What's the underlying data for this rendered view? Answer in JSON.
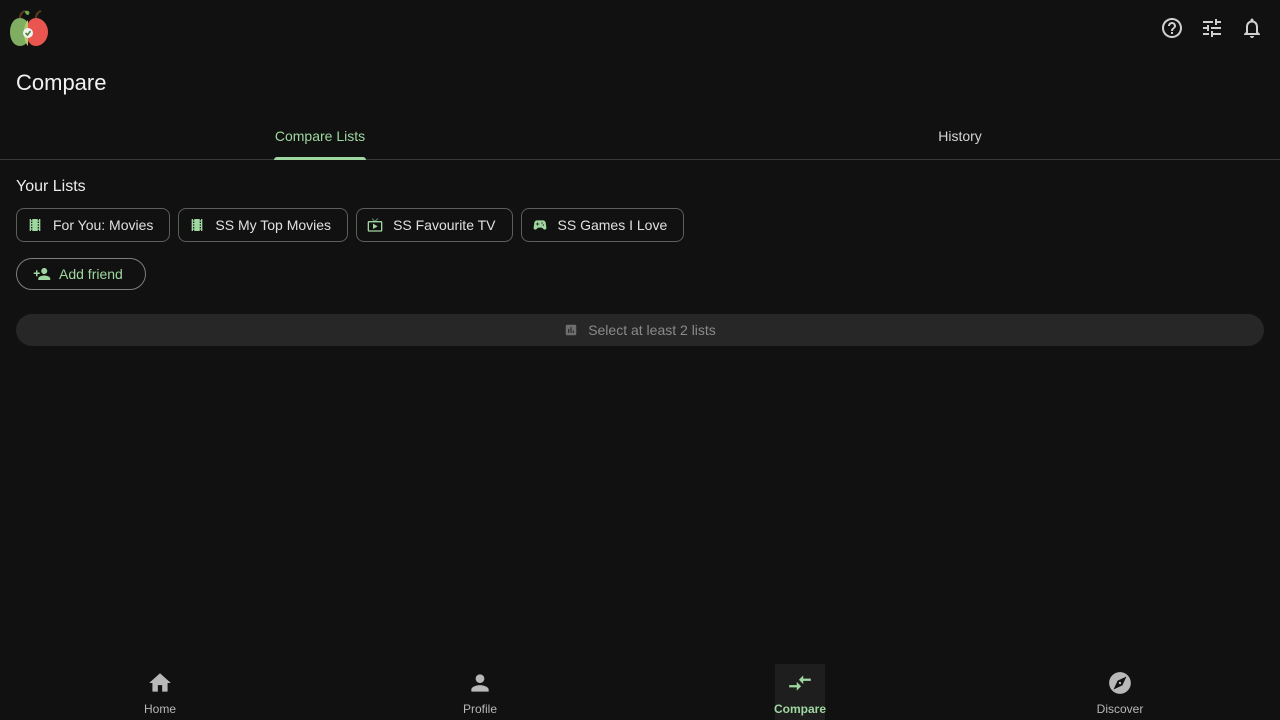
{
  "header": {
    "icons": [
      "help-icon",
      "tune-icon",
      "bell-icon"
    ]
  },
  "page": {
    "title": "Compare"
  },
  "tabs": [
    {
      "label": "Compare Lists",
      "active": true
    },
    {
      "label": "History",
      "active": false
    }
  ],
  "lists_section": {
    "title": "Your Lists",
    "chips": [
      {
        "label": "For You: Movies",
        "icon": "movie-icon"
      },
      {
        "label": "SS My Top Movies",
        "icon": "movie-icon"
      },
      {
        "label": "SS Favourite TV",
        "icon": "tv-icon"
      },
      {
        "label": "SS Games I Love",
        "icon": "gamepad-icon"
      }
    ],
    "add_friend_label": "Add friend",
    "compare_button_label": "Select at least 2 lists"
  },
  "bottom_nav": [
    {
      "label": "Home",
      "icon": "home-icon",
      "active": false
    },
    {
      "label": "Profile",
      "icon": "person-icon",
      "active": false
    },
    {
      "label": "Compare",
      "icon": "compare-arrows-icon",
      "active": true
    },
    {
      "label": "Discover",
      "icon": "compass-icon",
      "active": false
    }
  ],
  "colors": {
    "accent": "#9fd7a0",
    "background": "#111111",
    "surface": "#272727"
  }
}
